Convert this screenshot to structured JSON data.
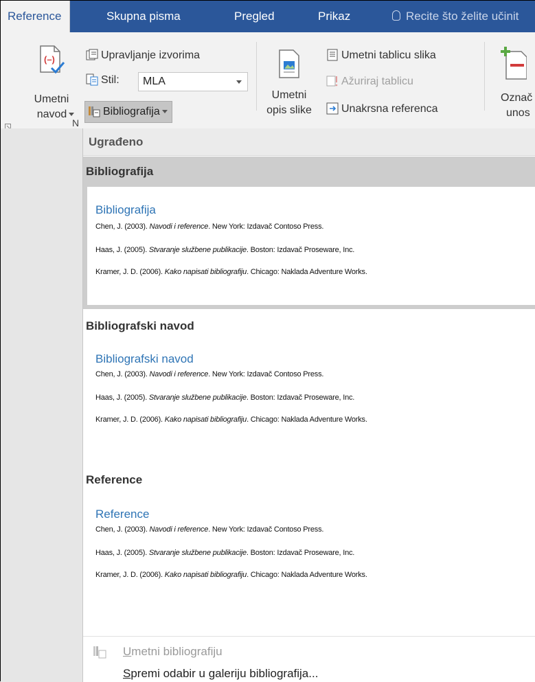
{
  "tabs": {
    "active": "Reference",
    "items": [
      "Skupna pisma",
      "Pregled",
      "Prikaz"
    ],
    "tell_me": "Recite što želite učinit"
  },
  "ribbon": {
    "insert_citation": {
      "line1": "Umetni",
      "line2": "navod"
    },
    "manage_sources": "Upravljanje izvorima",
    "style_label": "Stil:",
    "style_value": "MLA",
    "bibliography_button": "Bibliografija",
    "insert_caption": {
      "line1": "Umetni",
      "line2": "opis slike"
    },
    "insert_table_of_figures": "Umetni tablicu slika",
    "update_table": "Ažuriraj tablicu",
    "cross_reference": "Unakrsna referenca",
    "mark_entry": {
      "line1": "Označ",
      "line2": "unos"
    },
    "group_label_fragment": "N"
  },
  "dropdown": {
    "builtin_header": "Ugrađeno",
    "items": [
      {
        "title": "Bibliografija",
        "preview_title": "Bibliografija",
        "entries": [
          {
            "pre": "Chen, J. (2003). ",
            "italic": "Navodi i reference",
            "post": ". New York: Izdavač Contoso Press."
          },
          {
            "pre": "Haas, J. (2005). ",
            "italic": "Stvaranje službene publikacije",
            "post": ". Boston: Izdavač Proseware, Inc."
          },
          {
            "pre": "Kramer, J. D. (2006). ",
            "italic": "Kako napisati bibliografiju",
            "post": ". Chicago: Naklada Adventure Works."
          }
        ]
      },
      {
        "title": "Bibliografski navod",
        "preview_title": "Bibliografski navod",
        "entries": [
          {
            "pre": "Chen, J. (2003). ",
            "italic": "Navodi i reference",
            "post": ". New York: Izdavač Contoso Press."
          },
          {
            "pre": "Haas, J. (2005). ",
            "italic": "Stvaranje službene publikacije",
            "post": ". Boston: Izdavač Proseware, Inc."
          },
          {
            "pre": "Kramer, J. D. (2006). ",
            "italic": "Kako napisati bibliografiju",
            "post": ". Chicago: Naklada Adventure Works."
          }
        ]
      },
      {
        "title": "Reference",
        "preview_title": "Reference",
        "entries": [
          {
            "pre": "Chen, J. (2003). ",
            "italic": "Navodi i reference",
            "post": ". New York: Izdavač Contoso Press."
          },
          {
            "pre": "Haas, J. (2005). ",
            "italic": "Stvaranje službene publikacije",
            "post": ". Boston: Izdavač Proseware, Inc."
          },
          {
            "pre": "Kramer, J. D. (2006). ",
            "italic": "Kako napisati bibliografiju",
            "post": ". Chicago: Naklada Adventure Works."
          }
        ]
      }
    ],
    "insert_bibliography": {
      "mnemonic": "U",
      "rest": "metni bibliografiju"
    },
    "save_selection": {
      "mnemonic": "S",
      "rest": "premi odabir u galeriju bibliografija..."
    }
  }
}
